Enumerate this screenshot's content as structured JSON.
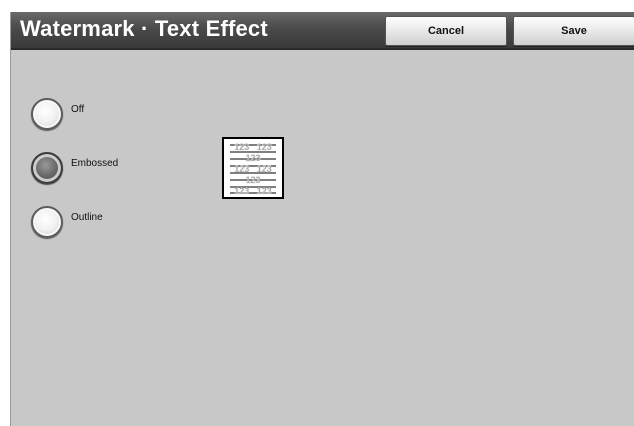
{
  "header": {
    "title": "Watermark · Text Effect",
    "cancel_label": "Cancel",
    "save_label": "Save"
  },
  "options": [
    {
      "label": "Off",
      "selected": false
    },
    {
      "label": "Embossed",
      "selected": true
    },
    {
      "label": "Outline",
      "selected": false
    }
  ],
  "preview": {
    "rows": [
      "123   123",
      "123",
      "123   123",
      "123",
      "123   123"
    ]
  },
  "colors": {
    "header_bg": "#4a4a4a",
    "panel_bg": "#c8c8c8",
    "title_text": "#ffffff"
  }
}
